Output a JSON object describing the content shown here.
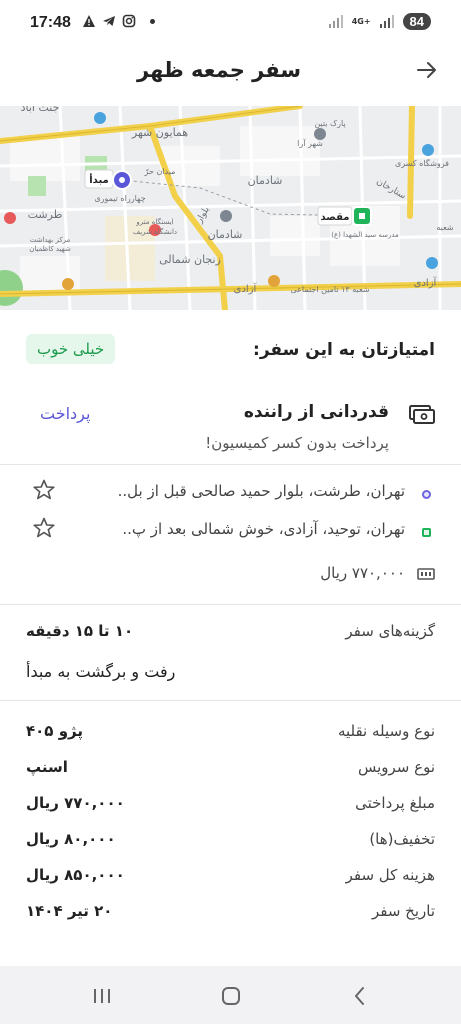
{
  "status_bar": {
    "time": "17:48",
    "network": "4G+",
    "battery": "84"
  },
  "header": {
    "title": "سفر جمعه ظهر",
    "back_icon": "arrow-right-icon"
  },
  "map": {
    "origin_label": "مبدأ",
    "destination_label": "مقصد",
    "places": [
      "جنت آباد",
      "همایون شهر",
      "پارک بتین",
      "شهر آرا",
      "شادمان",
      "میدان حرّ",
      "چهارراه تیموری",
      "بلوار",
      "ایستگاه مترو دانشگاه شریف",
      "شادمان",
      "زنجان شمالی",
      "آزادی",
      "طرشت",
      "مرکز بهداشت شهید کاظمیان",
      "شعبه ۱۳ تامین اجتماعی",
      "آزادی",
      "فروشگاه کسری",
      "ستارخان",
      "مدرسه سید الشهدا (ع)",
      "شعبه"
    ]
  },
  "rating": {
    "label": "امتیازتان به این سفر:",
    "value": "خیلی خوب"
  },
  "tip": {
    "title": "قدردانی از راننده",
    "subtitle": "پرداخت بدون کسر کمیسیون!",
    "pay_label": "پرداخت"
  },
  "addresses": [
    {
      "text": "تهران، طرشت، بلوار حمید صالحی قبل از بل..",
      "color": "#6b63e0"
    },
    {
      "text": "تهران، توحید، آزادی، خوش شمالی بعد از پ..",
      "color": "#1fb35a"
    }
  ],
  "price": "۷۷۰,۰۰۰ ریال",
  "options": {
    "label": "گزینه‌های سفر",
    "value": "۱۰ تا ۱۵ دقیقه",
    "extra": "رفت و برگشت به مبدأ"
  },
  "details": [
    {
      "key": "نوع وسیله نقلیه",
      "value": "پژو ۴۰۵"
    },
    {
      "key": "نوع سرویس",
      "value": "اسنپ"
    },
    {
      "key": "مبلغ پرداختی",
      "value": "۷۷۰,۰۰۰ ریال"
    },
    {
      "key": "تخفیف(ها)",
      "value": "۸۰,۰۰۰ ریال"
    },
    {
      "key": "هزینه کل سفر",
      "value": "۸۵۰,۰۰۰ ریال"
    },
    {
      "key": "تاریخ سفر",
      "value": "۲۰ تیر ۱۴۰۴"
    }
  ],
  "colors": {
    "accent": "#5b57d9",
    "good": "#1b9a4b",
    "origin": "#5b57d9",
    "destination": "#1fb35a"
  }
}
